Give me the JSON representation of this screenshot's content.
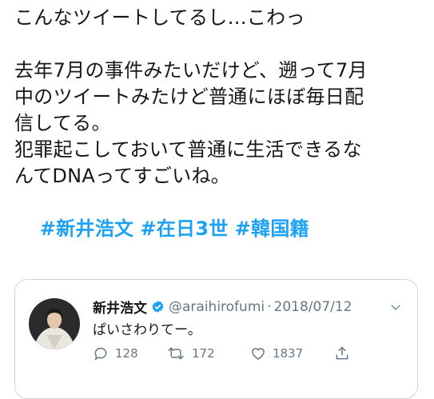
{
  "tweet": {
    "line1": "こんなツイートしてるし…こわっ",
    "line2": "去年7月の事件みたいだけど、遡って7月",
    "line3": "中のツイートみたけど普通にほぼ毎日配",
    "line4": "信してる。",
    "line5": "犯罪起こしておいて普通に生活できるな",
    "line6": "んてDNAってすごいね。",
    "hashtags": [
      "#新井浩文",
      "#在日3世",
      "#韓国籍"
    ]
  },
  "quote": {
    "name": "新井浩文",
    "handle": "@araihirofumi",
    "separator": "·",
    "date": "2018/07/12",
    "text": "ぱいさわりてー。",
    "reply_count": "128",
    "retweet_count": "172",
    "like_count": "1837"
  },
  "colors": {
    "link": "#1da1f2",
    "muted": "#657786",
    "border": "#ccd6dd"
  },
  "icons": [
    "verified-icon",
    "chevron-down-icon",
    "reply-icon",
    "retweet-icon",
    "like-icon",
    "share-icon"
  ]
}
